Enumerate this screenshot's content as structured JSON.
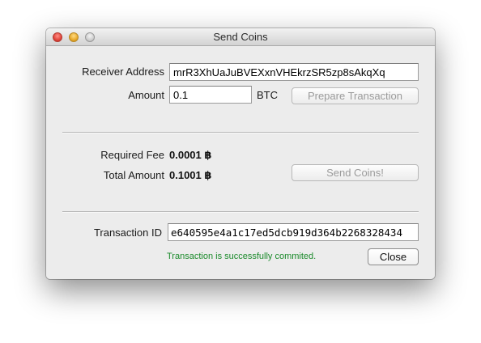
{
  "window": {
    "title": "Send Coins"
  },
  "form": {
    "receiver_label": "Receiver Address",
    "receiver_value": "mrR3XhUaJuBVEXxnVHEkrzSR5zp8sAkqXq",
    "amount_label": "Amount",
    "amount_value": "0.1",
    "amount_unit": "BTC",
    "prepare_button": "Prepare Transaction"
  },
  "summary": {
    "fee_label": "Required Fee",
    "fee_value": "0.0001 ฿",
    "total_label": "Total Amount",
    "total_value": "0.1001 ฿",
    "send_button": "Send Coins!"
  },
  "result": {
    "txid_label": "Transaction ID",
    "txid_value": "e640595e4a1c17ed5dcb919d364b2268328434",
    "status_text": "Transaction is successfully commited.",
    "status_color": "#1a8a2a",
    "close_button": "Close"
  }
}
